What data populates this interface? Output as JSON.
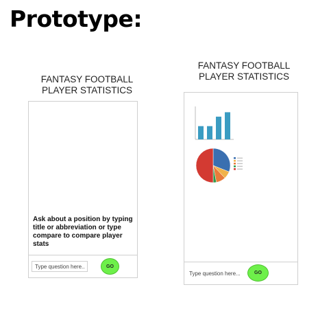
{
  "page": {
    "heading": "Prototype:"
  },
  "left_screen": {
    "title_line1": "FANTASY FOOTBALL",
    "title_line2": "PLAYER STATISTICS",
    "message": "Ask about a position by typing title or abbreviation or type compare to compare player stats",
    "input_placeholder": "Type question here...",
    "go_label": "GO"
  },
  "right_screen": {
    "title_line1": "FANTASY FOOTBALL",
    "title_line2": "PLAYER STATISTICS",
    "input_placeholder": "Type question here...",
    "go_label": "GO"
  },
  "chart_data": [
    {
      "type": "bar",
      "values": [
        0.42,
        0.42,
        0.72,
        0.86
      ],
      "colors": [
        "#3b9cc2"
      ]
    },
    {
      "type": "pie",
      "values": [
        0.31,
        0.07,
        0.09,
        0.03,
        0.5
      ],
      "colors": [
        "#3a6fb0",
        "#f0b24a",
        "#e87b3a",
        "#2f9a4a",
        "#d33a32"
      ]
    }
  ]
}
